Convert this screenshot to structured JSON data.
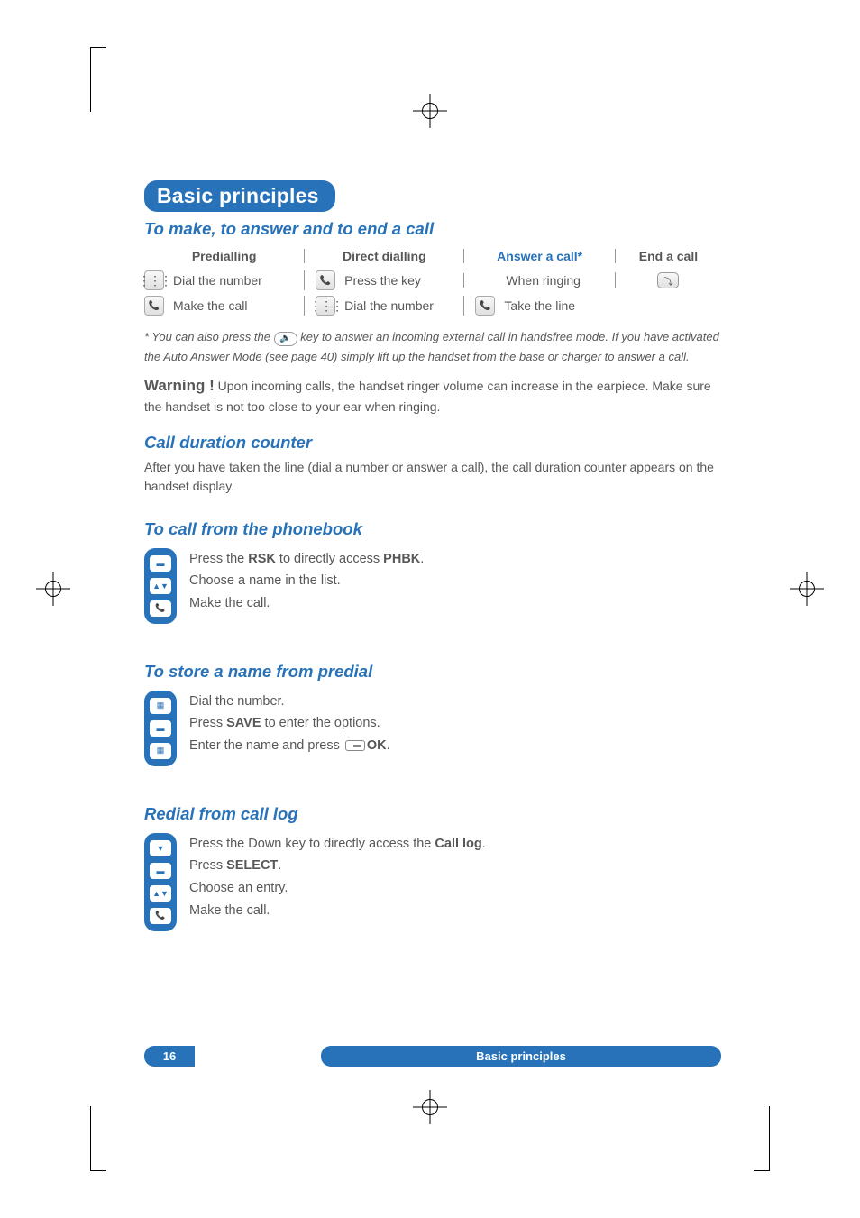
{
  "title": "Basic principles",
  "section1": {
    "heading": "To make, to answer and to end a call",
    "cols": {
      "predial": "Predialling",
      "direct": "Direct dialling",
      "answer": "Answer a call*",
      "end": "End a call"
    },
    "rows": {
      "predial1": "Dial the number",
      "predial2": "Make the call",
      "direct1": "Press the key",
      "direct2": "Dial the number",
      "answer1": "When ringing",
      "answer2": "Take the line"
    }
  },
  "footnote_pre": "* You can also press the ",
  "footnote_mid": " key to answer an incoming external call in handsfree mode. If you have activated the Auto Answer Mode (see page 40) simply lift up the handset from the base or charger to answer a call.",
  "warning_label": "Warning !",
  "warning_text": " Upon incoming calls, the handset ringer volume can increase in the earpiece. Make sure the handset is not too close to your ear when ringing.",
  "duration": {
    "heading": "Call duration counter",
    "text": "After you have taken the line (dial a number or answer a call), the call duration counter appears on the handset display."
  },
  "phonebook": {
    "heading": "To call from the phonebook",
    "line1a": "Press the ",
    "line1b": "RSK",
    "line1c": " to directly access ",
    "line1d": "PHBK",
    "line1e": ".",
    "line2": "Choose a name in the list.",
    "line3": "Make the call."
  },
  "store": {
    "heading": "To store a name from predial",
    "line1": "Dial the number.",
    "line2a": "Press ",
    "line2b": "SAVE",
    "line2c": " to enter the options.",
    "line3a": "Enter the name and press ",
    "line3b": "OK",
    "line3c": "."
  },
  "redial": {
    "heading": "Redial from call log",
    "line1a": "Press the Down key to directly access the ",
    "line1b": "Call log",
    "line1c": ".",
    "line2a": "Press ",
    "line2b": "SELECT",
    "line2c": ".",
    "line3": "Choose an entry.",
    "line4": "Make the call."
  },
  "footer": {
    "page": "16",
    "label": "Basic principles"
  }
}
